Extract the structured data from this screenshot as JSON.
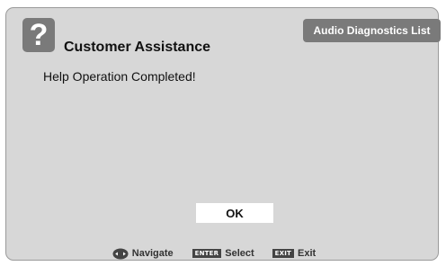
{
  "dialog": {
    "title": "Customer Assistance",
    "help_icon_glyph": "?",
    "tab_label": "Audio Diagnostics List",
    "message": "Help Operation Completed!",
    "ok_label": "OK"
  },
  "footer": {
    "navigate_label": "Navigate",
    "enter_key": "ENTER",
    "select_label": "Select",
    "exit_key": "EXIT",
    "exit_label": "Exit"
  },
  "icons": {
    "help": "question-mark-icon",
    "navigate": "navigate-dpad-icon",
    "enter": "enter-key-icon",
    "exit": "exit-key-icon"
  },
  "colors": {
    "panel_background": "#d7d7d7",
    "header_gray": "#7a7a7a",
    "button_background": "#ffffff"
  }
}
